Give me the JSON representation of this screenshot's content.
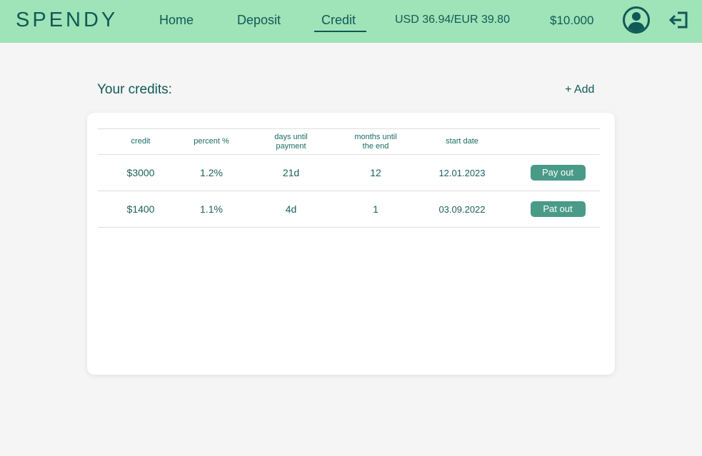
{
  "header": {
    "logo": "SPENDY",
    "nav": {
      "home": "Home",
      "deposit": "Deposit",
      "credit": "Credit"
    },
    "exchange_rate": "USD 36.94/EUR 39.80",
    "balance": "$10.000",
    "icons": {
      "avatar": "user-circle-icon",
      "logout": "logout-icon"
    }
  },
  "credits": {
    "title": "Your credits:",
    "add_label": "+ Add",
    "columns": {
      "credit": "credit",
      "percent": "percent %",
      "days_line1": "days until",
      "days_line2": "payment",
      "months_line1": "months until",
      "months_line2": "the end",
      "start": "start date"
    },
    "rows": [
      {
        "credit": "$3000",
        "percent": "1.2%",
        "days": "21d",
        "months": "12",
        "start": "12.01.2023",
        "action": "Pay out"
      },
      {
        "credit": "$1400",
        "percent": "1.1%",
        "days": "4d",
        "months": "1",
        "start": "03.09.2022",
        "action": "Pat out"
      }
    ]
  },
  "colors": {
    "header_bg": "#9fe3b8",
    "accent": "#0f5a55",
    "button_bg": "#4a9a88",
    "page_bg": "#f5f5f5"
  }
}
